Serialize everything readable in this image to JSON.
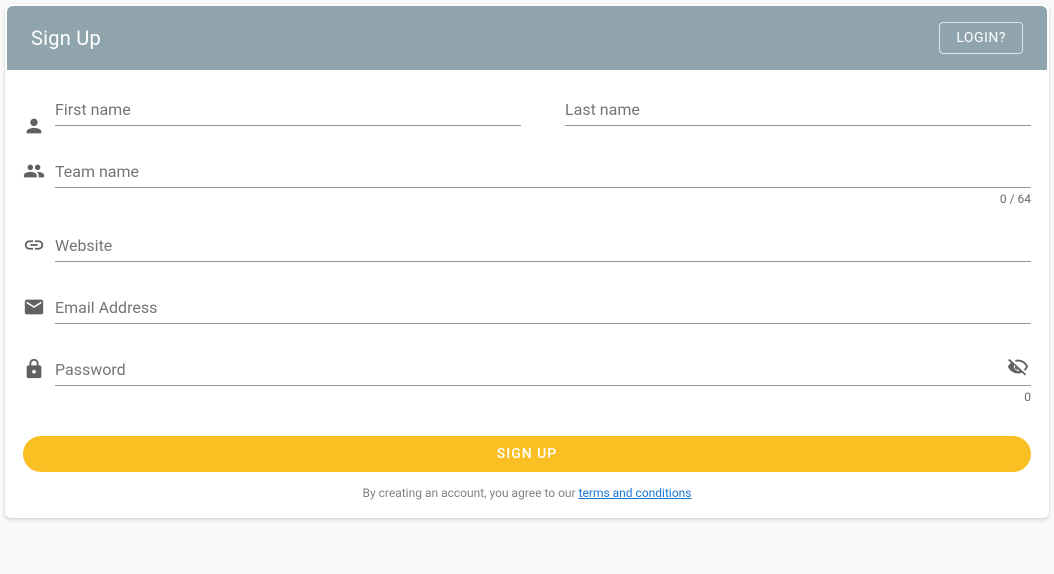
{
  "header": {
    "title": "Sign Up",
    "login_button": "LOGIN?"
  },
  "fields": {
    "first_name": {
      "placeholder": "First name",
      "value": ""
    },
    "last_name": {
      "placeholder": "Last name",
      "value": ""
    },
    "team_name": {
      "placeholder": "Team name",
      "value": "",
      "counter": "0 / 64"
    },
    "website": {
      "placeholder": "Website",
      "value": ""
    },
    "email": {
      "placeholder": "Email Address",
      "value": ""
    },
    "password": {
      "placeholder": "Password",
      "value": "",
      "counter": "0"
    }
  },
  "actions": {
    "signup_button": "SIGN UP"
  },
  "footer": {
    "terms_prefix": "By creating an account, you agree to our ",
    "terms_link": "terms and conditions"
  }
}
